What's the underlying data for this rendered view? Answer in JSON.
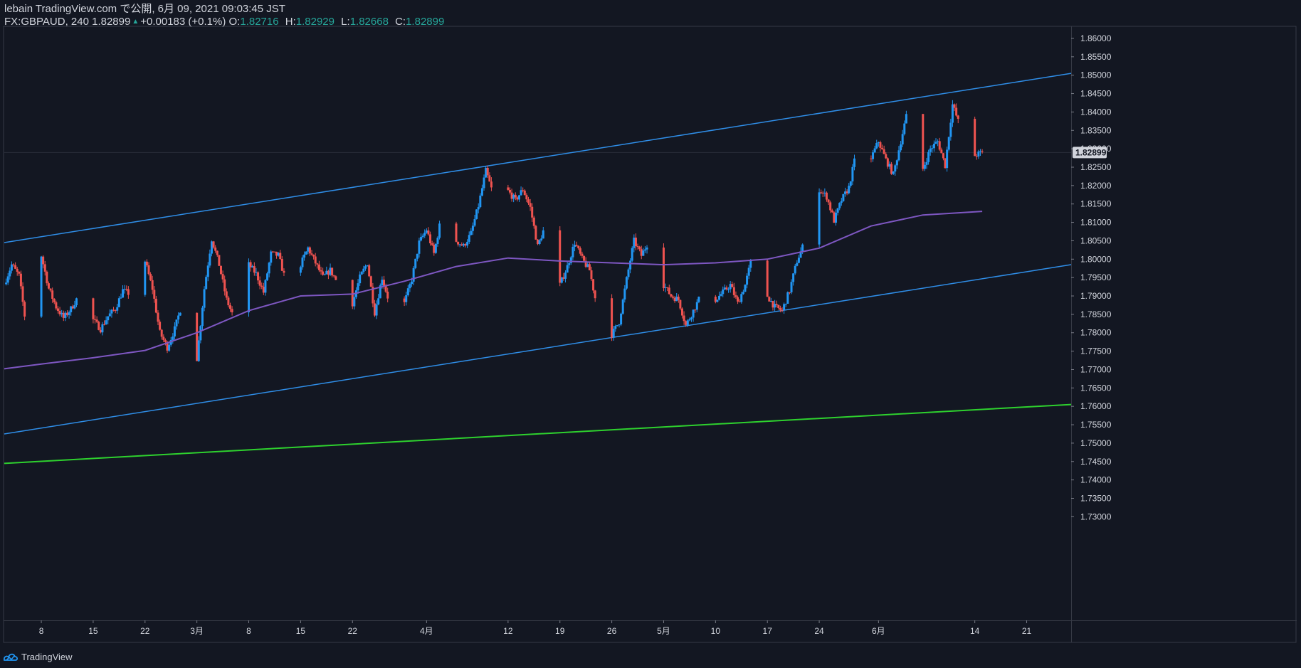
{
  "header": {
    "publisher": "lebain TradingView.com で公開, 6月 09, 2021 09:03:45 JST",
    "symbol": "FX:GBPAUD, 240",
    "last": "1.82899",
    "change": "+0.00183 (+0.1%)",
    "ohlc": [
      {
        "label": "O:",
        "value": "1.82716"
      },
      {
        "label": "H:",
        "value": "1.82929"
      },
      {
        "label": "L:",
        "value": "1.82668"
      },
      {
        "label": "C:",
        "value": "1.82899"
      }
    ]
  },
  "brand": "TradingView",
  "colors": {
    "background": "#131722",
    "up_candle": "#2196f3",
    "down_candle": "#ef5350",
    "channel": "#2f8ee8",
    "moving_average": "#7e57c2",
    "support_line": "#2ed12e",
    "price_label_bg": "#d1d4dc",
    "text": "#d1d4dc",
    "green_text": "#26a69a"
  },
  "chart_data": {
    "type": "candlestick",
    "y_axis": {
      "range": [
        1.7262,
        1.8627
      ],
      "ticks": [
        "1.73000",
        "1.73500",
        "1.74000",
        "1.74500",
        "1.75000",
        "1.75500",
        "1.76000",
        "1.76500",
        "1.77000",
        "1.77500",
        "1.78000",
        "1.78500",
        "1.79000",
        "1.79500",
        "1.80000",
        "1.80500",
        "1.81000",
        "1.81500",
        "1.82000",
        "1.82500",
        "1.83000",
        "1.83500",
        "1.84000",
        "1.84500",
        "1.85000",
        "1.85500",
        "1.86000"
      ]
    },
    "x_axis": {
      "range": [
        "2021-02-03",
        "2021-06-27"
      ],
      "ticks": [
        {
          "date": "2021-02-08",
          "label": "8"
        },
        {
          "date": "2021-02-15",
          "label": "15"
        },
        {
          "date": "2021-02-22",
          "label": "22"
        },
        {
          "date": "2021-03-01",
          "label": "3月"
        },
        {
          "date": "2021-03-08",
          "label": "8"
        },
        {
          "date": "2021-03-15",
          "label": "15"
        },
        {
          "date": "2021-03-22",
          "label": "22"
        },
        {
          "date": "2021-04-01",
          "label": "4月"
        },
        {
          "date": "2021-04-12",
          "label": "12"
        },
        {
          "date": "2021-04-19",
          "label": "19"
        },
        {
          "date": "2021-04-26",
          "label": "26"
        },
        {
          "date": "2021-05-03",
          "label": "5月"
        },
        {
          "date": "2021-05-10",
          "label": "10"
        },
        {
          "date": "2021-05-17",
          "label": "17"
        },
        {
          "date": "2021-05-24",
          "label": "24"
        },
        {
          "date": "2021-06-01",
          "label": "6月"
        },
        {
          "date": "2021-06-14",
          "label": "14"
        },
        {
          "date": "2021-06-21",
          "label": "21"
        }
      ]
    },
    "current_price": {
      "value": 1.82899,
      "label": "1.82899"
    },
    "close_path": [
      [
        "2021-02-03",
        1.7932
      ],
      [
        "2021-02-04",
        1.7985
      ],
      [
        "2021-02-05",
        1.7955
      ],
      [
        "2021-02-06",
        1.781
      ],
      [
        "2021-02-07",
        1.7995
      ],
      [
        "2021-02-08",
        1.801
      ],
      [
        "2021-02-09",
        1.792
      ],
      [
        "2021-02-10",
        1.787
      ],
      [
        "2021-02-11",
        1.784
      ],
      [
        "2021-02-12",
        1.7865
      ],
      [
        "2021-02-13",
        1.79
      ],
      [
        "2021-02-14",
        1.789
      ],
      [
        "2021-02-15",
        1.7835
      ],
      [
        "2021-02-16",
        1.781
      ],
      [
        "2021-02-17",
        1.7845
      ],
      [
        "2021-02-18",
        1.7865
      ],
      [
        "2021-02-19",
        1.7915
      ],
      [
        "2021-02-20",
        1.7905
      ],
      [
        "2021-02-21",
        1.7865
      ],
      [
        "2021-02-22",
        1.7995
      ],
      [
        "2021-02-23",
        1.792
      ],
      [
        "2021-02-24",
        1.78
      ],
      [
        "2021-02-25",
        1.776
      ],
      [
        "2021-02-26",
        1.781
      ],
      [
        "2021-02-27",
        1.788
      ],
      [
        "2021-02-28",
        1.781
      ],
      [
        "2021-03-01",
        1.773
      ],
      [
        "2021-03-02",
        1.792
      ],
      [
        "2021-03-03",
        1.8055
      ],
      [
        "2021-03-04",
        1.7985
      ],
      [
        "2021-03-05",
        1.789
      ],
      [
        "2021-03-06",
        1.784
      ],
      [
        "2021-03-07",
        1.792
      ],
      [
        "2021-03-08",
        1.7985
      ],
      [
        "2021-03-09",
        1.796
      ],
      [
        "2021-03-10",
        1.791
      ],
      [
        "2021-03-11",
        1.8015
      ],
      [
        "2021-03-12",
        1.801
      ],
      [
        "2021-03-13",
        1.794
      ],
      [
        "2021-03-14",
        1.807
      ],
      [
        "2021-03-15",
        1.7985
      ],
      [
        "2021-03-16",
        1.803
      ],
      [
        "2021-03-17",
        1.799
      ],
      [
        "2021-03-18",
        1.795
      ],
      [
        "2021-03-19",
        1.797
      ],
      [
        "2021-03-20",
        1.7935
      ],
      [
        "2021-03-21",
        1.7955
      ],
      [
        "2021-03-22",
        1.788
      ],
      [
        "2021-03-23",
        1.795
      ],
      [
        "2021-03-24",
        1.799
      ],
      [
        "2021-03-25",
        1.7855
      ],
      [
        "2021-03-26",
        1.795
      ],
      [
        "2021-03-27",
        1.788
      ],
      [
        "2021-03-28",
        1.793
      ],
      [
        "2021-03-29",
        1.788
      ],
      [
        "2021-03-30",
        1.7945
      ],
      [
        "2021-03-31",
        1.8045
      ],
      [
        "2021-04-01",
        1.808
      ],
      [
        "2021-04-02",
        1.8015
      ],
      [
        "2021-04-03",
        1.8115
      ],
      [
        "2021-04-04",
        1.807
      ],
      [
        "2021-04-05",
        1.805
      ],
      [
        "2021-04-06",
        1.8035
      ],
      [
        "2021-04-07",
        1.807
      ],
      [
        "2021-04-08",
        1.8145
      ],
      [
        "2021-04-09",
        1.824
      ],
      [
        "2021-04-10",
        1.8175
      ],
      [
        "2021-04-11",
        1.816
      ],
      [
        "2021-04-12",
        1.8185
      ],
      [
        "2021-04-13",
        1.816
      ],
      [
        "2021-04-14",
        1.819
      ],
      [
        "2021-04-15",
        1.814
      ],
      [
        "2021-04-16",
        1.8035
      ],
      [
        "2021-04-17",
        1.809
      ],
      [
        "2021-04-18",
        1.8
      ],
      [
        "2021-04-19",
        1.793
      ],
      [
        "2021-04-20",
        1.798
      ],
      [
        "2021-04-21",
        1.8045
      ],
      [
        "2021-04-22",
        1.8
      ],
      [
        "2021-04-23",
        1.797
      ],
      [
        "2021-04-24",
        1.787
      ],
      [
        "2021-04-25",
        1.779
      ],
      [
        "2021-04-26",
        1.7795
      ],
      [
        "2021-04-27",
        1.783
      ],
      [
        "2021-04-28",
        1.7945
      ],
      [
        "2021-04-29",
        1.805
      ],
      [
        "2021-04-30",
        1.801
      ],
      [
        "2021-05-01",
        1.805
      ],
      [
        "2021-05-02",
        1.796
      ],
      [
        "2021-05-03",
        1.793
      ],
      [
        "2021-05-04",
        1.79
      ],
      [
        "2021-05-05",
        1.789
      ],
      [
        "2021-05-06",
        1.782
      ],
      [
        "2021-05-07",
        1.786
      ],
      [
        "2021-05-08",
        1.79
      ],
      [
        "2021-05-09",
        1.792
      ],
      [
        "2021-05-10",
        1.789
      ],
      [
        "2021-05-11",
        1.791
      ],
      [
        "2021-05-12",
        1.793
      ],
      [
        "2021-05-13",
        1.788
      ],
      [
        "2021-05-14",
        1.793
      ],
      [
        "2021-05-15",
        1.801
      ],
      [
        "2021-05-16",
        1.795
      ],
      [
        "2021-05-17",
        1.79
      ],
      [
        "2021-05-18",
        1.787
      ],
      [
        "2021-05-19",
        1.786
      ],
      [
        "2021-05-20",
        1.7915
      ],
      [
        "2021-05-21",
        1.7995
      ],
      [
        "2021-05-22",
        1.8045
      ],
      [
        "2021-05-23",
        1.807
      ],
      [
        "2021-05-24",
        1.819
      ],
      [
        "2021-05-25",
        1.817
      ],
      [
        "2021-05-26",
        1.8105
      ],
      [
        "2021-05-27",
        1.816
      ],
      [
        "2021-05-28",
        1.8195
      ],
      [
        "2021-05-29",
        1.829
      ],
      [
        "2021-05-30",
        1.824
      ],
      [
        "2021-05-31",
        1.8275
      ],
      [
        "2021-06-01",
        1.832
      ],
      [
        "2021-06-02",
        1.827
      ],
      [
        "2021-06-03",
        1.823
      ],
      [
        "2021-06-04",
        1.832
      ],
      [
        "2021-06-05",
        1.841
      ],
      [
        "2021-06-06",
        1.836
      ],
      [
        "2021-06-07",
        1.8245
      ],
      [
        "2021-06-08",
        1.83
      ],
      [
        "2021-06-09",
        1.832
      ],
      [
        "2021-06-10",
        1.8255
      ],
      [
        "2021-06-11",
        1.842
      ],
      [
        "2021-06-12",
        1.836
      ],
      [
        "2021-06-13",
        1.827
      ],
      [
        "2021-06-14",
        1.8282
      ],
      [
        "2021-06-15",
        1.829
      ]
    ],
    "moving_average": {
      "points": [
        [
          "2021-02-03",
          1.7702
        ],
        [
          "2021-02-08",
          1.7715
        ],
        [
          "2021-02-15",
          1.7732
        ],
        [
          "2021-02-22",
          1.7752
        ],
        [
          "2021-03-01",
          1.78
        ],
        [
          "2021-03-08",
          1.786
        ],
        [
          "2021-03-15",
          1.79
        ],
        [
          "2021-03-22",
          1.7905
        ],
        [
          "2021-03-29",
          1.794
        ],
        [
          "2021-04-05",
          1.798
        ],
        [
          "2021-04-12",
          1.8003
        ],
        [
          "2021-04-19",
          1.7995
        ],
        [
          "2021-04-26",
          1.799
        ],
        [
          "2021-05-03",
          1.7985
        ],
        [
          "2021-05-10",
          1.799
        ],
        [
          "2021-05-17",
          1.8
        ],
        [
          "2021-05-24",
          1.803
        ],
        [
          "2021-05-31",
          1.809
        ],
        [
          "2021-06-07",
          1.812
        ],
        [
          "2021-06-15",
          1.813
        ]
      ]
    },
    "trend_lines": [
      {
        "role": "channel-upper",
        "from": [
          "2021-02-03",
          1.8045
        ],
        "to": [
          "2021-06-27",
          1.8505
        ]
      },
      {
        "role": "channel-lower",
        "from": [
          "2021-02-03",
          1.7525
        ],
        "to": [
          "2021-06-27",
          1.7985
        ]
      },
      {
        "role": "support",
        "from": [
          "2021-02-03",
          1.7445
        ],
        "to": [
          "2021-06-27",
          1.7605
        ]
      }
    ]
  }
}
